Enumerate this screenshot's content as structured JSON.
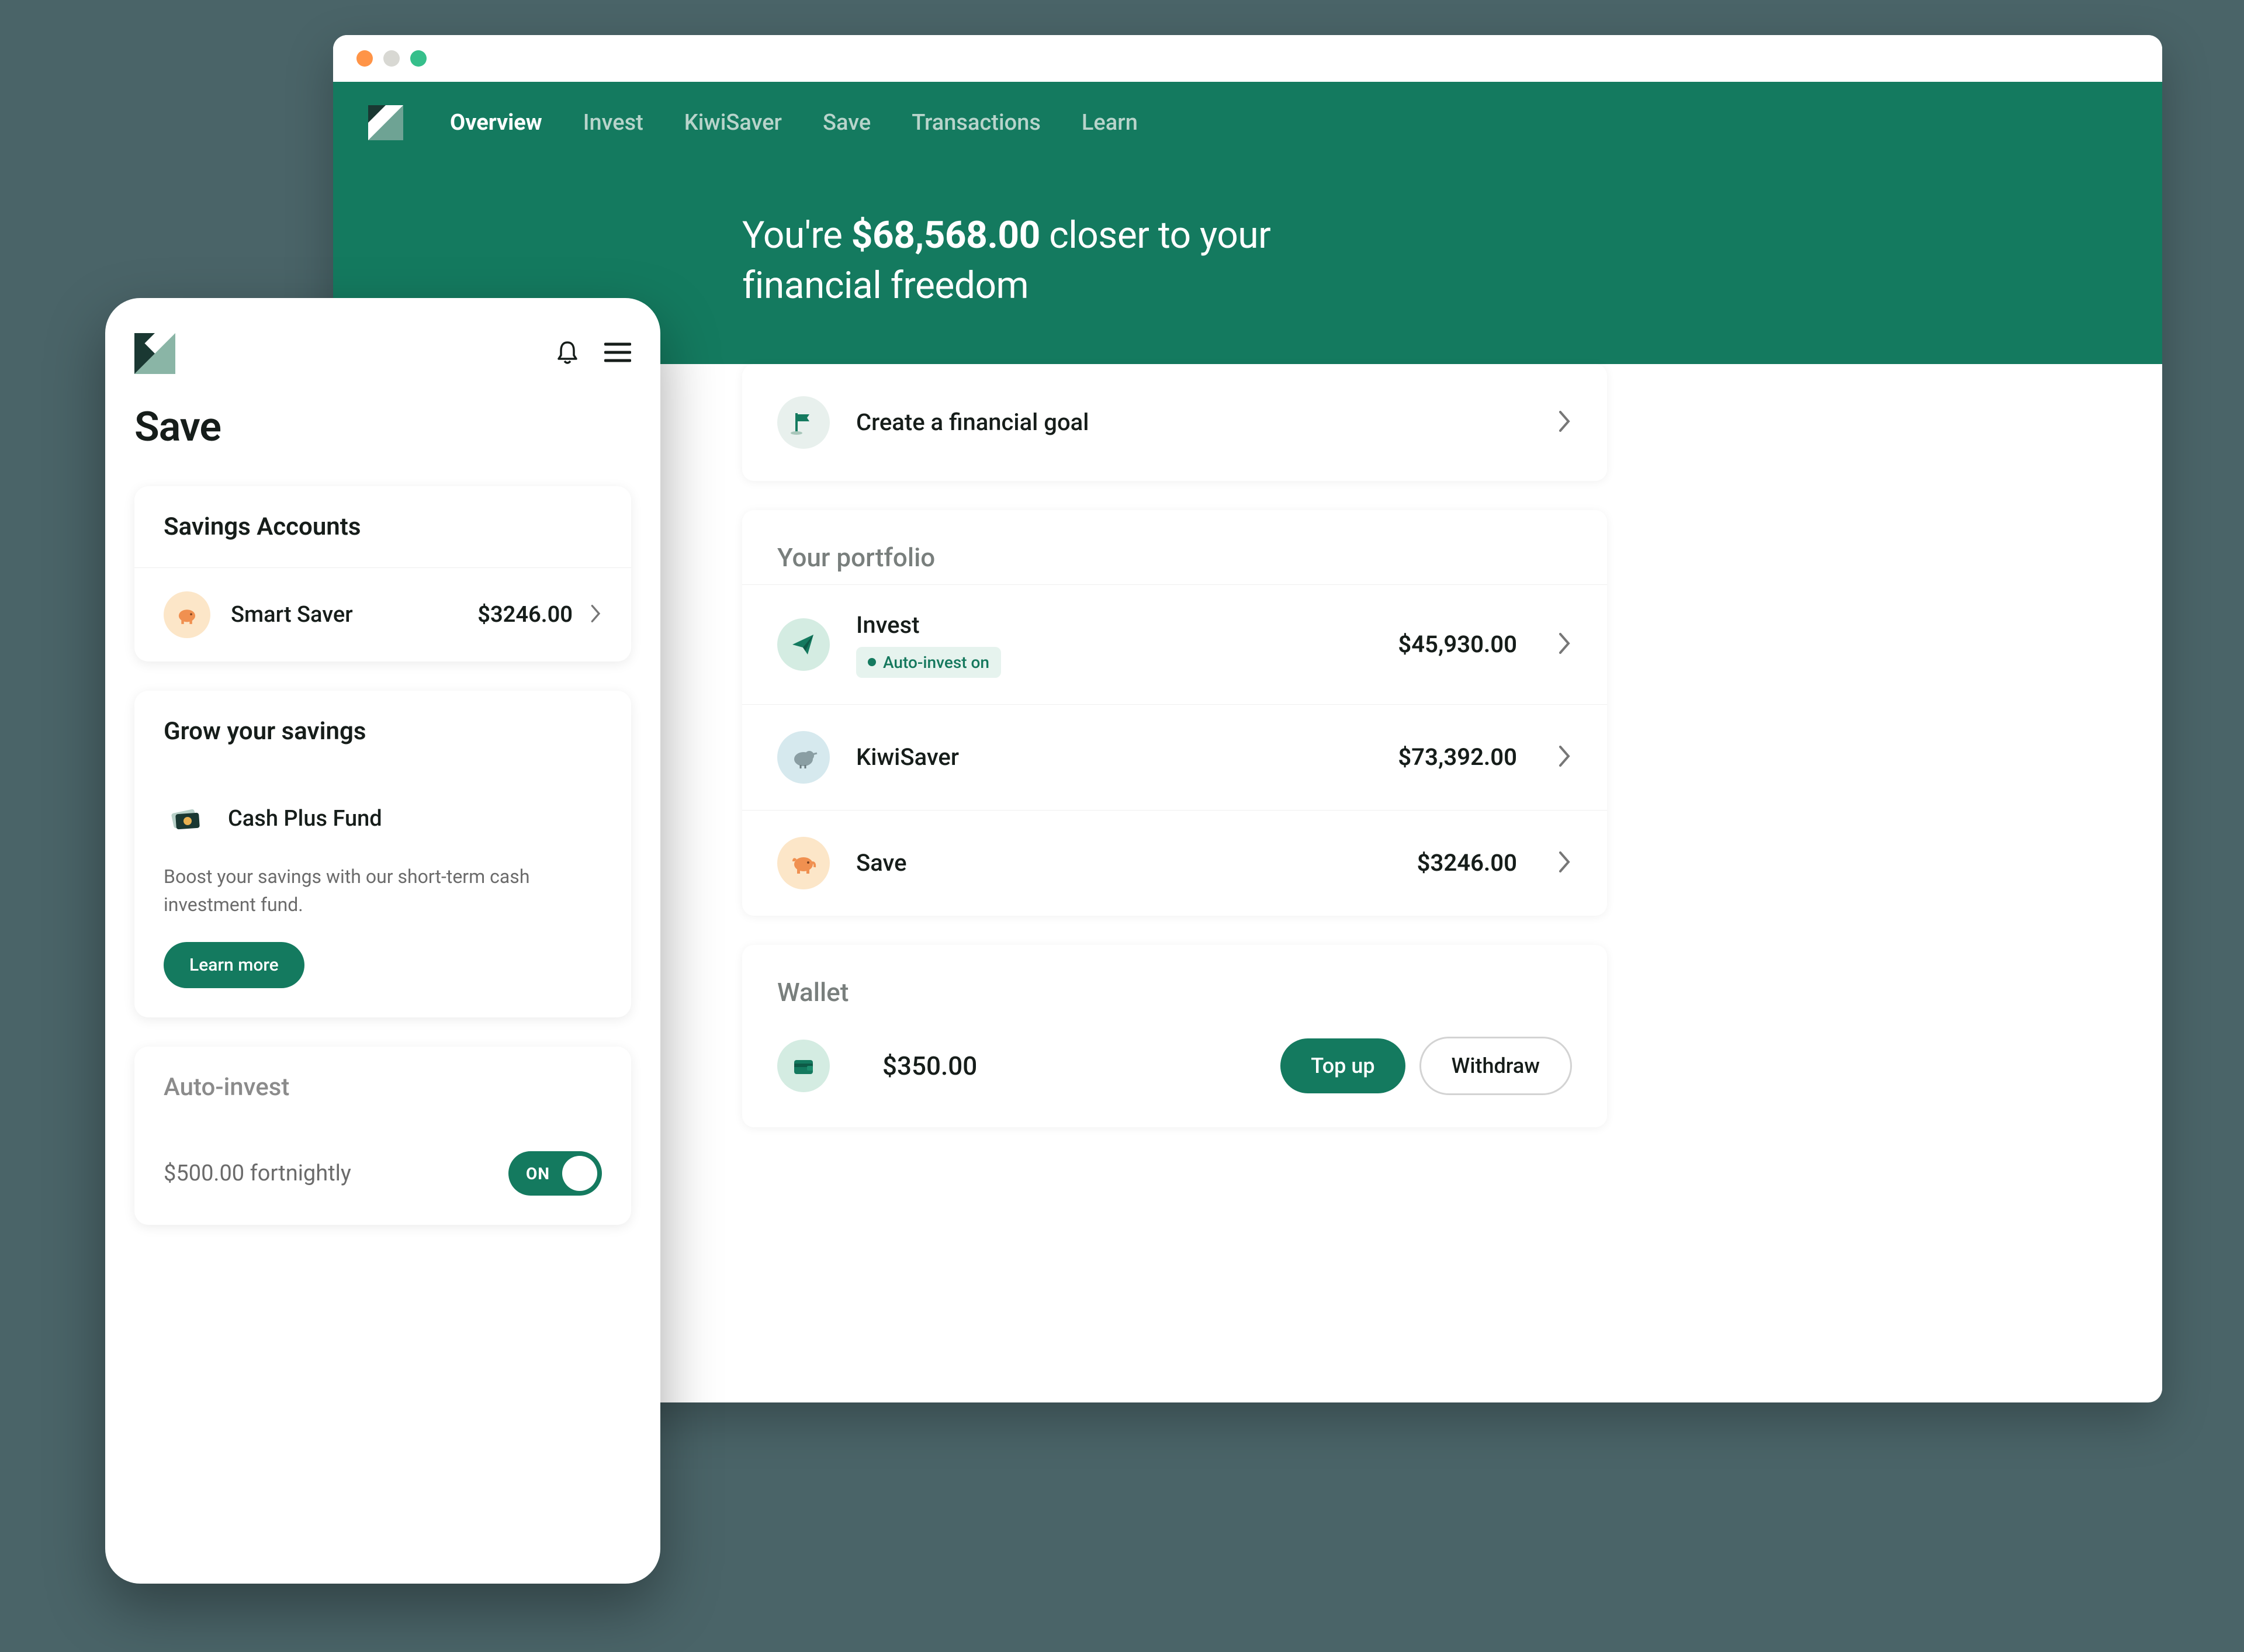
{
  "desktop": {
    "nav": {
      "items": [
        {
          "label": "Overview",
          "active": true
        },
        {
          "label": "Invest",
          "active": false
        },
        {
          "label": "KiwiSaver",
          "active": false
        },
        {
          "label": "Save",
          "active": false
        },
        {
          "label": "Transactions",
          "active": false
        },
        {
          "label": "Learn",
          "active": false
        }
      ]
    },
    "hero": {
      "prefix": "You're ",
      "amount": "$68,568.00",
      "suffix": " closer to your financial freedom"
    },
    "goal": {
      "label": "Create a financial goal"
    },
    "portfolio": {
      "title": "Your portfolio",
      "items": [
        {
          "label": "Invest",
          "amount": "$45,930.00",
          "badge": "Auto-invest on",
          "icon": "paper-plane"
        },
        {
          "label": "KiwiSaver",
          "amount": "$73,392.00",
          "icon": "kiwi"
        },
        {
          "label": "Save",
          "amount": "$3246.00",
          "icon": "piggy"
        }
      ]
    },
    "wallet": {
      "title": "Wallet",
      "amount": "$350.00",
      "topup_label": "Top up",
      "withdraw_label": "Withdraw"
    }
  },
  "mobile": {
    "title": "Save",
    "savings": {
      "header": "Savings Accounts",
      "items": [
        {
          "label": "Smart Saver",
          "amount": "$3246.00"
        }
      ]
    },
    "grow": {
      "header": "Grow your savings",
      "fund_name": "Cash Plus Fund",
      "description": "Boost your savings with our short-term cash investment fund.",
      "cta": "Learn more"
    },
    "auto_invest": {
      "header": "Auto-invest",
      "schedule": "$500.00 fortnightly",
      "toggle_label": "ON"
    }
  },
  "colors": {
    "brand_green": "#147a5f",
    "bg": "#4a6468"
  }
}
